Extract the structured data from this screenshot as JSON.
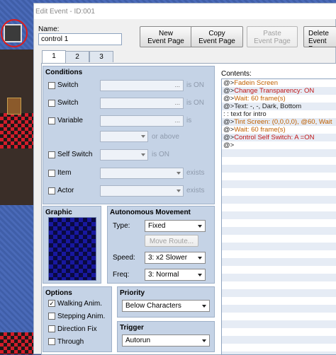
{
  "window": {
    "title": "Edit Event - ID:001"
  },
  "name": {
    "label": "Name:",
    "value": "control 1"
  },
  "toolbar": {
    "new_label_1": "New",
    "new_label_2": "Event Page",
    "copy_label_1": "Copy",
    "copy_label_2": "Event Page",
    "paste_label_1": "Paste",
    "paste_label_2": "Event Page",
    "delete_label_1": "Delete",
    "delete_label_2": "Event Page"
  },
  "tabs": [
    {
      "label": "1"
    },
    {
      "label": "2"
    },
    {
      "label": "3"
    }
  ],
  "conditions": {
    "title": "Conditions",
    "switch1": {
      "label": "Switch",
      "field": "...",
      "suffix": "is ON"
    },
    "switch2": {
      "label": "Switch",
      "field": "...",
      "suffix": "is ON"
    },
    "variable": {
      "label": "Variable",
      "field": "...",
      "suffix": "is"
    },
    "above_suffix": "or above",
    "self_switch": {
      "label": "Self Switch",
      "suffix": "is ON"
    },
    "item": {
      "label": "Item",
      "suffix": "exists"
    },
    "actor": {
      "label": "Actor",
      "suffix": "exists"
    }
  },
  "graphic": {
    "title": "Graphic"
  },
  "movement": {
    "title": "Autonomous Movement",
    "type_label": "Type:",
    "type_value": "Fixed",
    "move_route_label": "Move Route...",
    "speed_label": "Speed:",
    "speed_value": "3: x2 Slower",
    "freq_label": "Freq:",
    "freq_value": "3: Normal"
  },
  "options": {
    "title": "Options",
    "walking": {
      "label": "Walking Anim.",
      "checked": "✓"
    },
    "stepping": {
      "label": "Stepping Anim."
    },
    "direction": {
      "label": "Direction Fix"
    },
    "through": {
      "label": "Through"
    }
  },
  "priority": {
    "title": "Priority",
    "value": "Below Characters"
  },
  "trigger": {
    "title": "Trigger",
    "value": "Autorun"
  },
  "contents": {
    "label": "Contents:",
    "lines": [
      {
        "prefix": "@>",
        "text": "Fadein Screen",
        "color": "#c06000"
      },
      {
        "prefix": "@>",
        "text": "Change Transparency: ON",
        "color": "#c01515"
      },
      {
        "prefix": "@>",
        "text": "Wait: 60 frame(s)",
        "color": "#c06000"
      },
      {
        "prefix": "@>",
        "text": "Text: -, -, Dark, Bottom",
        "color": "#222222"
      },
      {
        "prefix": " :",
        "text": "      : text for intro",
        "color": "#222222"
      },
      {
        "prefix": "@>",
        "text": "Tint Screen: (0,0,0,0), @60, Wait",
        "color": "#c06000"
      },
      {
        "prefix": "@>",
        "text": "Wait: 60 frame(s)",
        "color": "#c06000"
      },
      {
        "prefix": "@>",
        "text": "Control Self Switch: A =ON",
        "color": "#c01515"
      },
      {
        "prefix": "@>",
        "text": "",
        "color": "#222222"
      }
    ]
  }
}
